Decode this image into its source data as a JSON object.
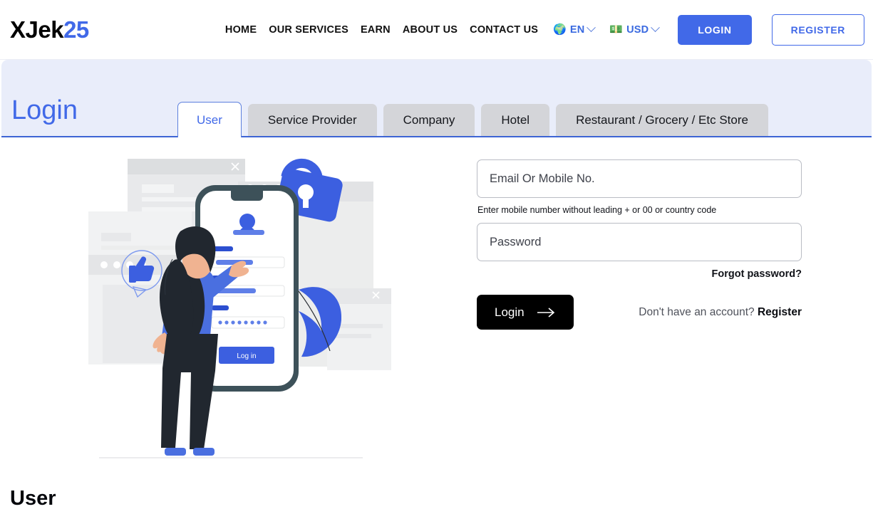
{
  "header": {
    "logo_dark": "XJek",
    "logo_accent": "25",
    "nav": [
      {
        "label": "HOME"
      },
      {
        "label": "OUR SERVICES"
      },
      {
        "label": "EARN"
      },
      {
        "label": "ABOUT US"
      },
      {
        "label": "CONTACT US"
      }
    ],
    "language": {
      "icon": "🌍",
      "label": "EN",
      "icon_name": "globe-icon"
    },
    "currency": {
      "icon": "💵",
      "label": "USD",
      "icon_name": "money-icon"
    },
    "login_button": "LOGIN",
    "register_button": "REGISTER"
  },
  "banner": {
    "title": "Login",
    "tabs": [
      {
        "label": "User",
        "active": true
      },
      {
        "label": "Service Provider",
        "active": false
      },
      {
        "label": "Company",
        "active": false
      },
      {
        "label": "Hotel",
        "active": false
      },
      {
        "label": "Restaurant / Grocery / Etc Store",
        "active": false
      }
    ]
  },
  "illustration": {
    "phone_button_label": "Log in",
    "alt": "woman pointing at mobile login screen with padlock"
  },
  "form": {
    "email_placeholder": "Email Or Mobile No.",
    "email_value": "",
    "help_text": "Enter mobile number without leading + or 00 or country code",
    "password_placeholder": "Password",
    "password_value": "",
    "forgot_link": "Forgot password?",
    "login_button": "Login",
    "account_question": "Don't have an account?",
    "register_link": "Register"
  },
  "page_footer": {
    "title": "User"
  },
  "colors": {
    "accent_blue": "#4169e8",
    "banner_bg": "#e9edfa",
    "tab_inactive_bg": "#d4d5d9",
    "button_black": "#000000",
    "border_blue": "#3d64d4"
  }
}
